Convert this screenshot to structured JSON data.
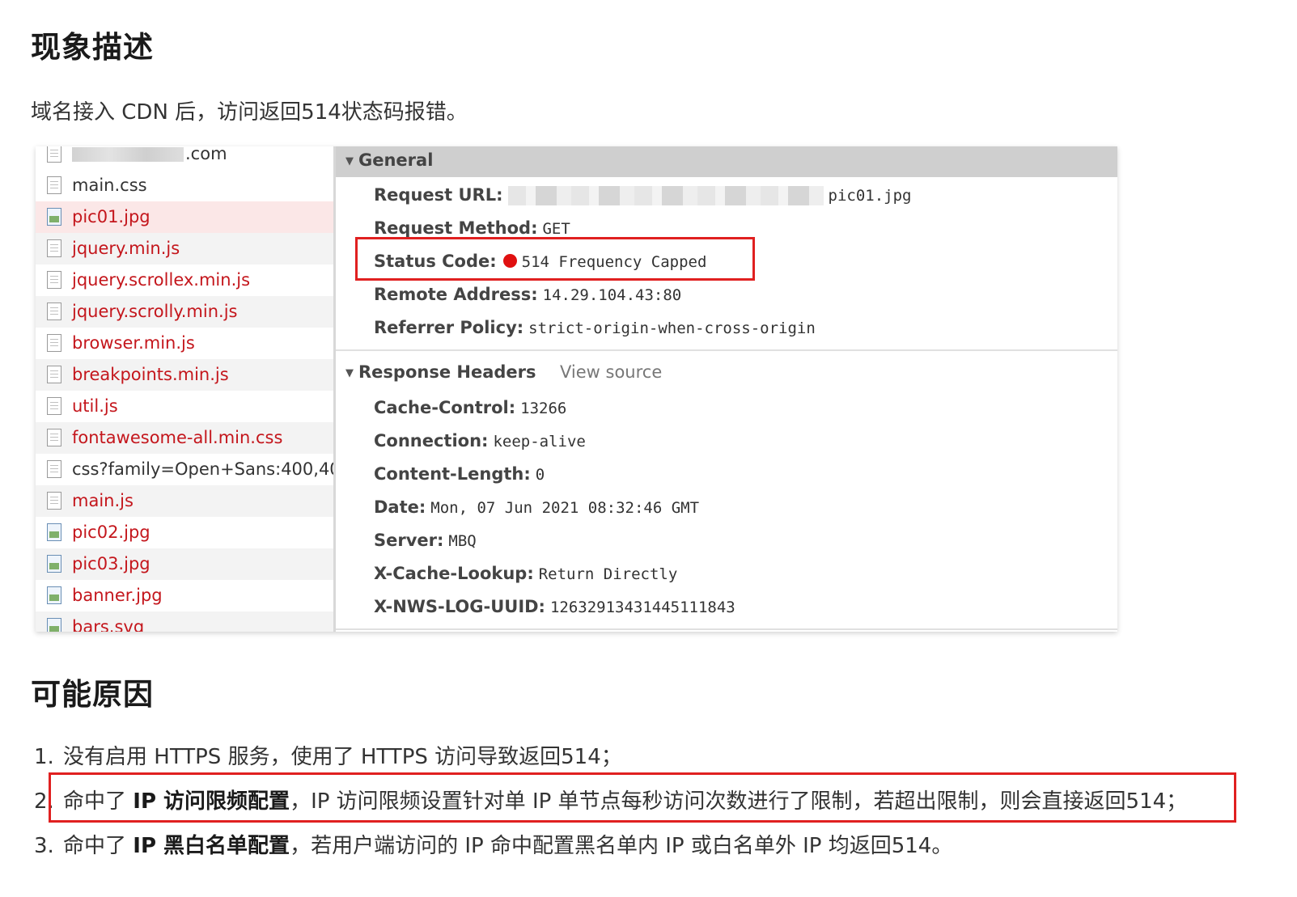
{
  "section1": {
    "title": "现象描述",
    "description": "域名接入 CDN 后，访问返回514状态码报错。"
  },
  "network_panel": {
    "files": [
      {
        "name": ".com",
        "type": "doc",
        "redacted": true,
        "color": "black"
      },
      {
        "name": "main.css",
        "type": "doc",
        "color": "black"
      },
      {
        "name": "pic01.jpg",
        "type": "img",
        "color": "red",
        "selected": true
      },
      {
        "name": "jquery.min.js",
        "type": "doc",
        "color": "red"
      },
      {
        "name": "jquery.scrollex.min.js",
        "type": "doc",
        "color": "red"
      },
      {
        "name": "jquery.scrolly.min.js",
        "type": "doc",
        "color": "red"
      },
      {
        "name": "browser.min.js",
        "type": "doc",
        "color": "red"
      },
      {
        "name": "breakpoints.min.js",
        "type": "doc",
        "color": "red"
      },
      {
        "name": "util.js",
        "type": "doc",
        "color": "red"
      },
      {
        "name": "fontawesome-all.min.css",
        "type": "doc",
        "color": "red"
      },
      {
        "name": "css?family=Open+Sans:400,40...",
        "type": "doc",
        "color": "black"
      },
      {
        "name": "main.js",
        "type": "doc",
        "color": "red"
      },
      {
        "name": "pic02.jpg",
        "type": "img",
        "color": "red"
      },
      {
        "name": "pic03.jpg",
        "type": "img",
        "color": "red"
      },
      {
        "name": "banner.jpg",
        "type": "img",
        "color": "red"
      },
      {
        "name": "bars.svg",
        "type": "img",
        "color": "red"
      }
    ],
    "general": {
      "title": "General",
      "request_url_label": "Request URL:",
      "request_url_value": "pic01.jpg",
      "request_method_label": "Request Method:",
      "request_method_value": "GET",
      "status_code_label": "Status Code:",
      "status_code_value": "514 Frequency Capped",
      "remote_address_label": "Remote Address:",
      "remote_address_value": "14.29.104.43:80",
      "referrer_policy_label": "Referrer Policy:",
      "referrer_policy_value": "strict-origin-when-cross-origin"
    },
    "response_headers": {
      "title": "Response Headers",
      "view_source": "View source",
      "items": [
        {
          "key": "Cache-Control:",
          "value": "13266"
        },
        {
          "key": "Connection:",
          "value": "keep-alive"
        },
        {
          "key": "Content-Length:",
          "value": "0"
        },
        {
          "key": "Date:",
          "value": "Mon, 07 Jun 2021 08:32:46 GMT"
        },
        {
          "key": "Server:",
          "value": "MBQ"
        },
        {
          "key": "X-Cache-Lookup:",
          "value": "Return Directly"
        },
        {
          "key": "X-NWS-LOG-UUID:",
          "value": "12632913431445111843"
        }
      ]
    },
    "colors": {
      "error_red": "#c4161c",
      "highlight_box": "#e02020",
      "status_dot": "#e01010"
    }
  },
  "section2": {
    "title": "可能原因",
    "items": [
      {
        "num": "1.",
        "pre": "没有启用 HTTPS 服务，使用了 HTTPS 访问导致返回514；",
        "bold": "",
        "post": ""
      },
      {
        "num": "2.",
        "pre": "命中了 ",
        "bold": "IP 访问限频配置",
        "post": "，IP 访问限频设置针对单 IP 单节点每秒访问次数进行了限制，若超出限制，则会直接返回514；"
      },
      {
        "num": "3.",
        "pre": "命中了 ",
        "bold": "IP 黑白名单配置",
        "post": "，若用户端访问的 IP 命中配置黑名单内 IP 或白名单外 IP 均返回514。"
      }
    ]
  }
}
